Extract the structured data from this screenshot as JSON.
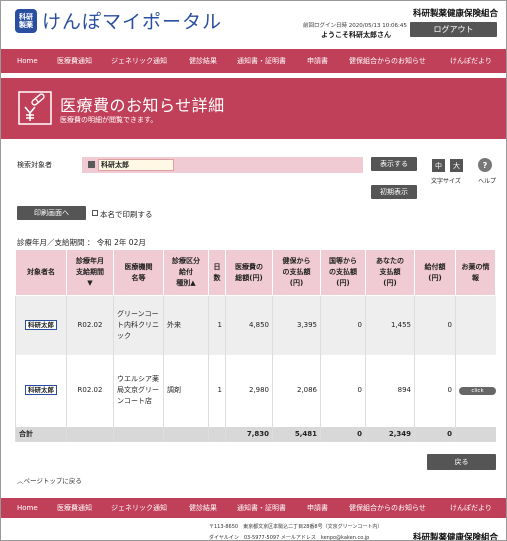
{
  "header": {
    "logo_mark": "科研\n製薬",
    "logo_text": "けんぽマイポータル",
    "org_name": "科研製薬健康保険組合",
    "last_login": "前回ログイン日時 2020/05/13 10:06:45",
    "welcome": "ようこそ科研太郎さん",
    "logout_label": "ログアウト"
  },
  "nav": [
    "Home",
    "医療費通知",
    "ジェネリック通知",
    "健診結果",
    "通知書・証明書",
    "申請書",
    "健保組合からのお知らせ",
    "けんぽだより"
  ],
  "banner": {
    "title": "医療費のお知らせ詳細",
    "subtitle": "医療費の明細が閲覧できます。",
    "icon": "medicine-yen-icon"
  },
  "search": {
    "label": "検索対象者",
    "value": "科研太郎",
    "search_button": "表示する",
    "reset_button": "初期表示",
    "size_medium": "中",
    "size_large": "大",
    "size_label": "文字サイズ",
    "help_glyph": "?",
    "help_label": "ヘルプ"
  },
  "print": {
    "button": "印刷画面へ",
    "checkbox_label": "本名で印刷する"
  },
  "period": "診療年月／支給期間 ： 令和 2年 02月",
  "table": {
    "headers": [
      "対象者名",
      "診療年月\n支給期間\n▼",
      "医療機関\n名等",
      "診療区分\n給付種別▲",
      "日数",
      "医療費の\n総額(円)",
      "健保から\nの支払額\n(円)",
      "国等から\nの支払額\n(円)",
      "あなたの\n支払額\n(円)",
      "給付額\n(円)",
      "お薬の情報"
    ],
    "rows": [
      {
        "name": "科研太郎",
        "period": "R02.02",
        "institution": "グリーンコート内科クリニック",
        "category": "外来",
        "days": "1",
        "total": "4,850",
        "kenpo": "3,395",
        "public": "0",
        "self": "1,455",
        "benefit": "0",
        "medicine": ""
      },
      {
        "name": "科研太郎",
        "period": "R02.02",
        "institution": "ウエルシア薬局文京グリーンコート店",
        "category": "調剤",
        "days": "1",
        "total": "2,980",
        "kenpo": "2,086",
        "public": "0",
        "self": "894",
        "benefit": "0",
        "medicine": "click"
      }
    ],
    "total_row": {
      "label": "合計",
      "total": "7,830",
      "kenpo": "5,481",
      "public": "0",
      "self": "2,349",
      "benefit": "0"
    }
  },
  "back_button": "戻る",
  "page_top": "ページトップに戻る",
  "footer": {
    "address": "〒113-8650　東京都文京区本駒込二丁目28番8号（文京グリーンコート内）",
    "tel": "ダイヤルイン　03-5977-5097 メールアドレス　kenpo@kaken.co.jp",
    "org_name": "科研製薬健康保険組合"
  }
}
